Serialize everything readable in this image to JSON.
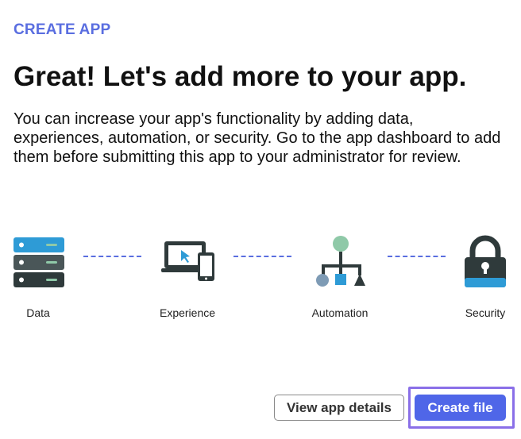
{
  "header": {
    "eyebrow": "CREATE APP",
    "title": "Great! Let's add more to your app.",
    "description": "You can increase your app's functionality by adding data, experiences, automation, or security. Go to the app dashboard to add them before submitting this app to your administrator for review."
  },
  "steps": [
    {
      "label": "Data",
      "icon": "server-stack-icon"
    },
    {
      "label": "Experience",
      "icon": "devices-icon"
    },
    {
      "label": "Automation",
      "icon": "flowchart-icon"
    },
    {
      "label": "Security",
      "icon": "padlock-icon"
    }
  ],
  "actions": {
    "secondary_label": "View app details",
    "primary_label": "Create file"
  },
  "colors": {
    "accent": "#5a6ee0",
    "primary_button": "#4f66e8",
    "focus_ring": "#8a6fe8",
    "icon_dark": "#2f3a3b",
    "icon_blue": "#2e9bd6",
    "icon_green": "#8fc9a8"
  }
}
